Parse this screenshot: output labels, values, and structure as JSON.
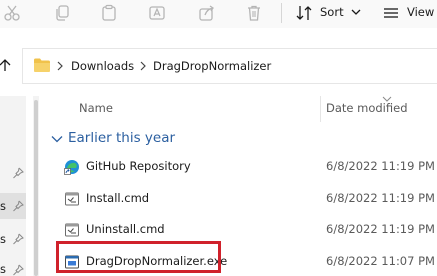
{
  "toolbar": {
    "sort_label": "Sort",
    "view_label": "View",
    "icons": [
      "cut-icon",
      "copy-icon",
      "paste-icon",
      "rename-icon",
      "share-icon",
      "delete-icon",
      "sort-icon",
      "view-icon"
    ]
  },
  "address": {
    "crumbs": [
      "Downloads",
      "DragDropNormalizer"
    ]
  },
  "columns": {
    "name": "Name",
    "date_modified": "Date modified"
  },
  "group": {
    "label": "Earlier this year"
  },
  "files": [
    {
      "name": "GitHub Repository",
      "date": "6/8/2022 11:19 PM",
      "icon": "edge-shortcut-icon"
    },
    {
      "name": "Install.cmd",
      "date": "6/8/2022 11:19 PM",
      "icon": "cmd-file-icon"
    },
    {
      "name": "Uninstall.cmd",
      "date": "6/8/2022 11:19 PM",
      "icon": "cmd-file-icon"
    },
    {
      "name": "DragDropNormalizer.exe",
      "date": "6/8/2022 11:07 PM",
      "icon": "exe-file-icon"
    }
  ],
  "nav": {
    "partial_labels": [
      "s",
      "s",
      "s"
    ]
  },
  "colors": {
    "accent_blue": "#2b5fa0",
    "highlight_red": "#d0212b",
    "folder_yellow": "#f0c24b"
  }
}
